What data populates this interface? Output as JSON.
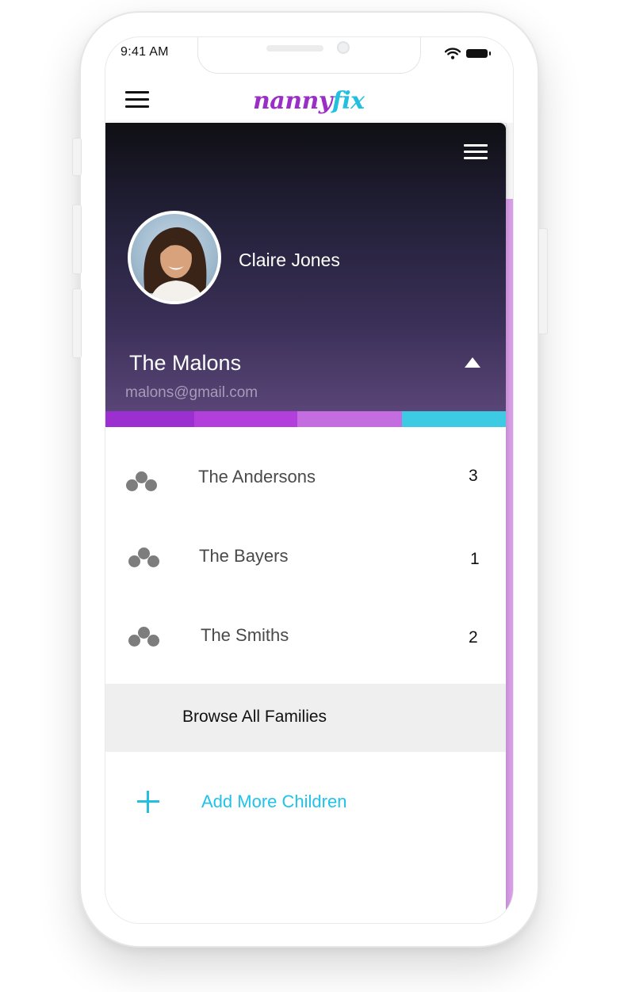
{
  "status_bar": {
    "time": "9:41 AM"
  },
  "app": {
    "logo_part1": "nanny",
    "logo_part2": "fix",
    "brand_colors": {
      "purple": "#9a2fc8",
      "cyan": "#22bfe0"
    }
  },
  "drawer": {
    "user_name": "Claire Jones",
    "current_family": {
      "name": "The Malons",
      "email": "malons@gmail.com"
    },
    "color_segments": [
      "#9b2fd0",
      "#b23fdb",
      "#c46de0",
      "#3ccbe3"
    ],
    "families": [
      {
        "name": "The Andersons",
        "count": "3"
      },
      {
        "name": "The Bayers",
        "count": "1"
      },
      {
        "name": "The Smiths",
        "count": "2"
      }
    ],
    "browse_label": "Browse All Families",
    "add_label": "Add More Children"
  },
  "icons": {
    "menu": "hamburger-menu-icon",
    "group": "family-group-icon",
    "expand": "caret-up-icon",
    "add": "plus-icon",
    "wifi": "wifi-icon",
    "battery": "battery-icon"
  }
}
